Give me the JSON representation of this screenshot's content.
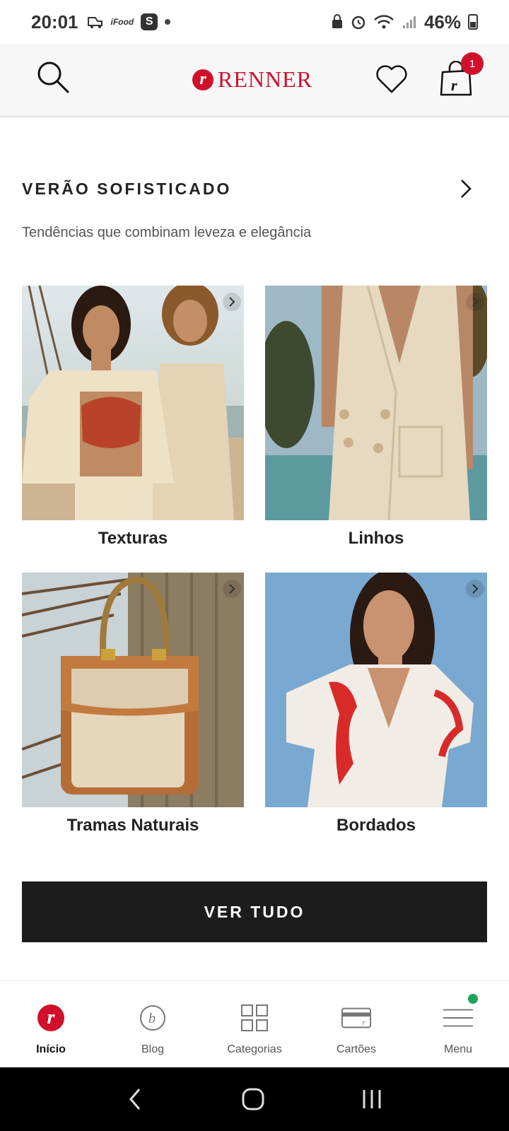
{
  "status_bar": {
    "time": "20:01",
    "notif_s": "S",
    "notif_small": "iFood",
    "battery": "46%"
  },
  "header": {
    "brand": "RENNER",
    "brand_mark": "r",
    "cart_count": "1"
  },
  "section": {
    "title": "VERÃO SOFISTICADO",
    "subtitle": "Tendências que combinam leveza e elegância"
  },
  "cards": [
    {
      "label": "Texturas"
    },
    {
      "label": "Linhos"
    },
    {
      "label": "Tramas Naturais"
    },
    {
      "label": "Bordados"
    }
  ],
  "cta": {
    "label": "VER TUDO"
  },
  "bottom_nav": {
    "items": [
      {
        "label": "Início",
        "icon": "renner-logo-icon",
        "active": true
      },
      {
        "label": "Blog",
        "icon": "blog-icon"
      },
      {
        "label": "Categorias",
        "icon": "grid-icon"
      },
      {
        "label": "Cartões",
        "icon": "card-icon"
      },
      {
        "label": "Menu",
        "icon": "hamburger-icon"
      }
    ]
  },
  "colors": {
    "brand_red": "#d0102b",
    "cta_bg": "#1c1c1c",
    "notification_green": "#1aa65a"
  }
}
